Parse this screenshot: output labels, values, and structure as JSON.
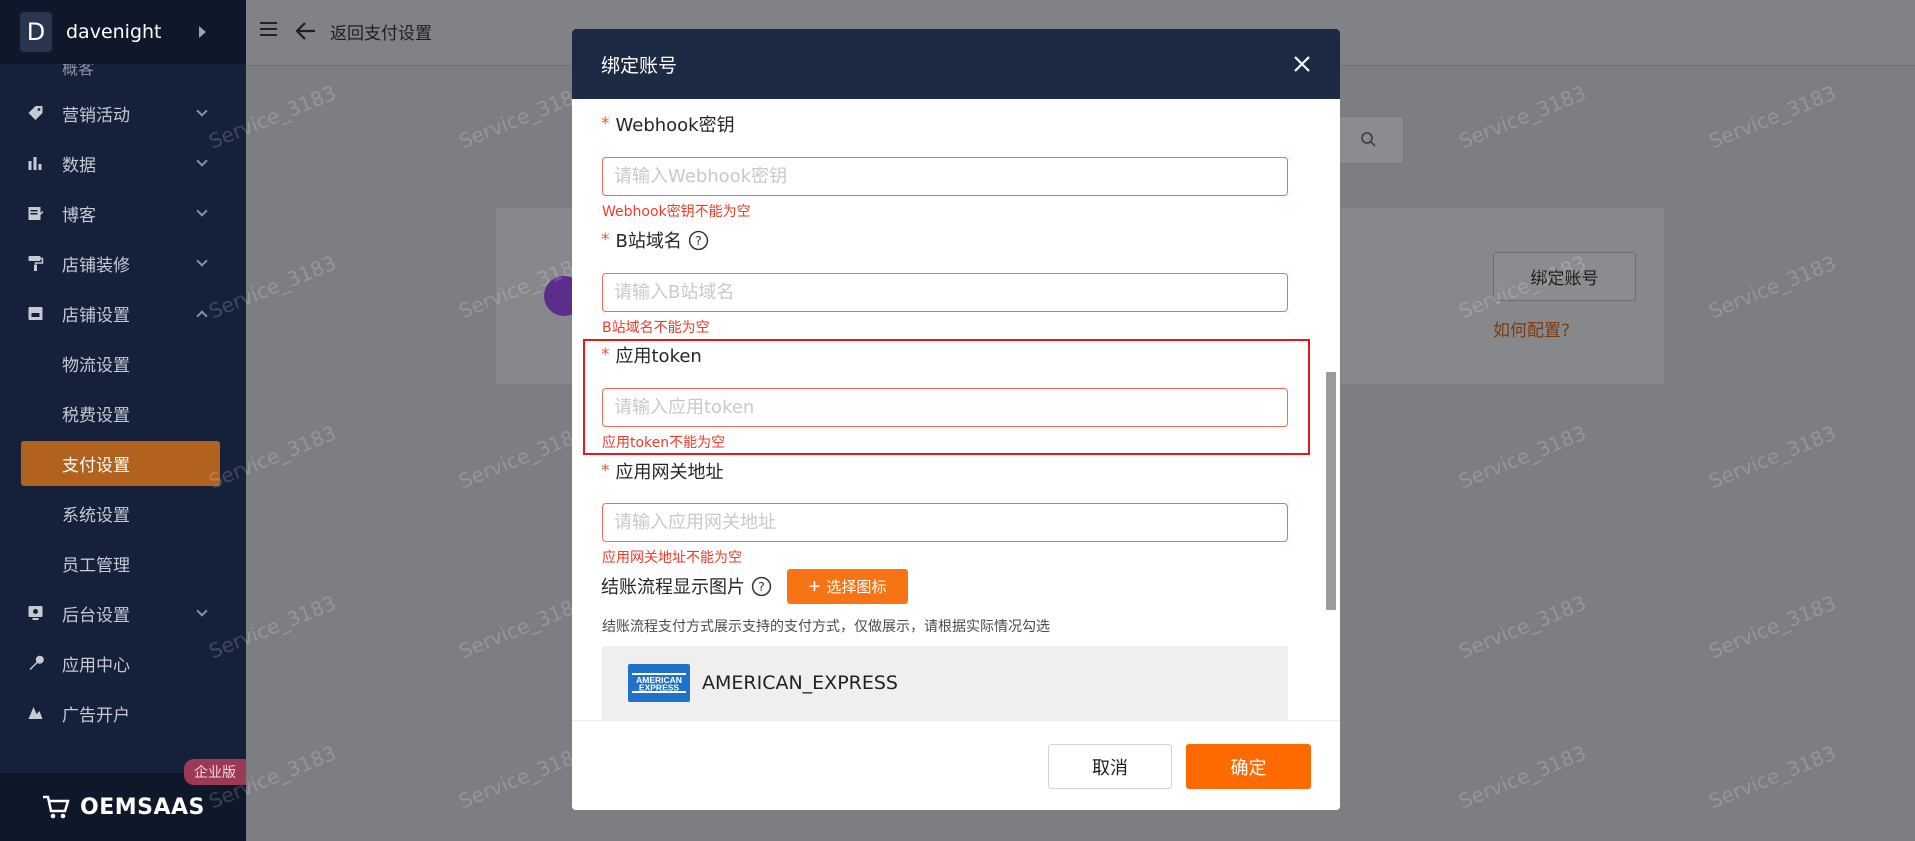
{
  "sidebar": {
    "brand_initial": "D",
    "brand_name": "davenight",
    "cut_item": "概客",
    "items": [
      {
        "label": "营销活动",
        "icon": "tag-icon"
      },
      {
        "label": "数据",
        "icon": "bar-chart-icon"
      },
      {
        "label": "博客",
        "icon": "edit-icon"
      },
      {
        "label": "店铺装修",
        "icon": "paint-roller-icon"
      },
      {
        "label": "店铺设置",
        "icon": "store-icon"
      }
    ],
    "sub_items": [
      "物流设置",
      "税费设置",
      "支付设置",
      "系统设置",
      "员工管理"
    ],
    "active_sub": "支付设置",
    "more_items": [
      {
        "label": "后台设置",
        "icon": "monitor-icon"
      },
      {
        "label": "应用中心",
        "icon": "wrench-icon"
      },
      {
        "label": "广告开户",
        "icon": "ad-icon"
      }
    ],
    "footer_logo": "OEMSAAS",
    "footer_badge": "企业版"
  },
  "topbar": {
    "back_label": "返回支付设置"
  },
  "background_card": {
    "bind_button": "绑定账号",
    "howto_link": "如何配置?"
  },
  "watermark": "Service_3183",
  "modal": {
    "title": "绑定账号",
    "fields": [
      {
        "label": "Webhook密钥",
        "required": true,
        "help": false,
        "placeholder": "请输入Webhook密钥",
        "error": "Webhook密钥不能为空"
      },
      {
        "label": "B站域名",
        "required": true,
        "help": true,
        "placeholder": "请输入B站域名",
        "error": "B站域名不能为空"
      },
      {
        "label": "应用token",
        "required": true,
        "help": false,
        "placeholder": "请输入应用token",
        "error": "应用token不能为空"
      },
      {
        "label": "应用网关地址",
        "required": true,
        "help": false,
        "placeholder": "请输入应用网关地址",
        "error": "应用网关地址不能为空"
      }
    ],
    "checkout_label": "结账流程显示图片",
    "select_icon_button": "选择图标",
    "checkout_hint": "结账流程支付方式展示支持的支付方式，仅做展示，请根据实际情况勾选",
    "payment_method": {
      "name": "AMERICAN_EXPRESS",
      "logo_top": "AMERICAN",
      "logo_bottom": "EXPRESS"
    },
    "cancel_label": "取消",
    "confirm_label": "确定"
  },
  "colors": {
    "sidebar_bg": "#15203a",
    "active_item": "#b0621e",
    "modal_header": "#1c2a44",
    "primary": "#ff6a00",
    "error": "#ef3b28",
    "highlight": "#e41a1a"
  }
}
